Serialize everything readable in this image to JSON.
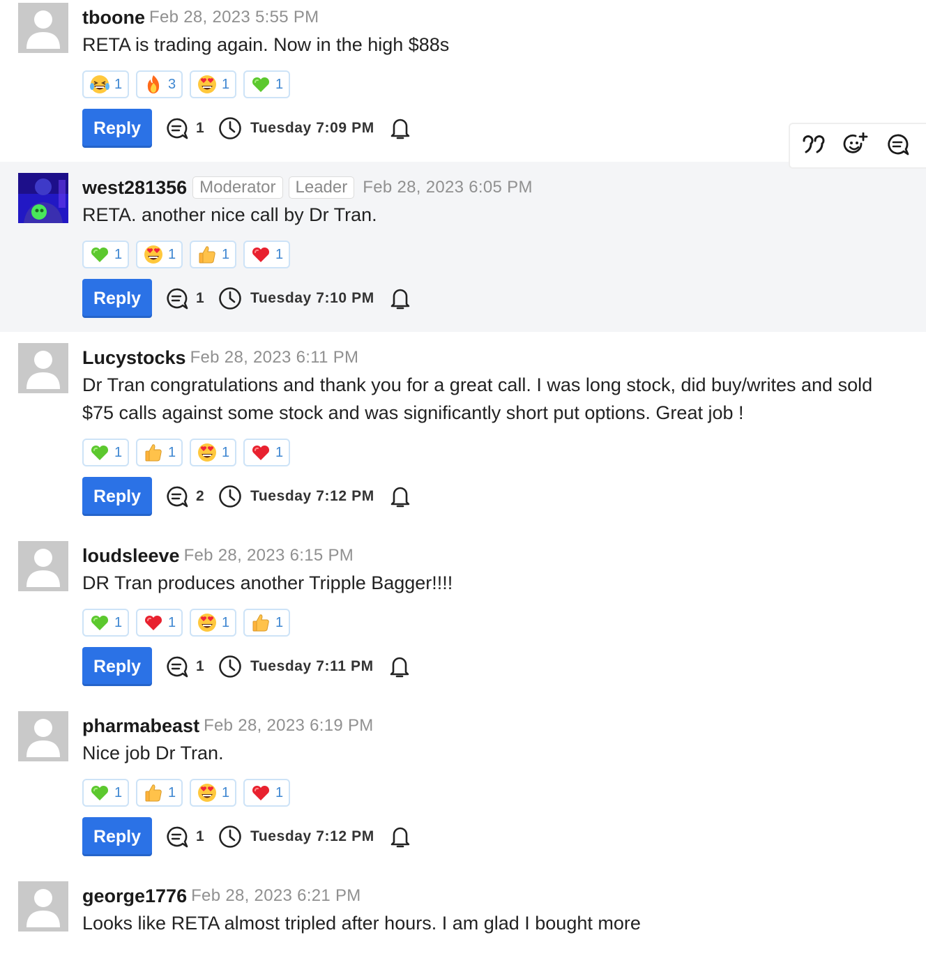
{
  "toolbar": {
    "icons": [
      "quote-icon",
      "add-reaction-icon",
      "comment-icon"
    ]
  },
  "posts": [
    {
      "username": "tboone",
      "badges": [],
      "timestamp": "Feb 28, 2023 5:55 PM",
      "body": "RETA is trading again. Now in the high $88s",
      "reactions": [
        {
          "emoji": "laughing-tears",
          "count": "1"
        },
        {
          "emoji": "fire",
          "count": "3"
        },
        {
          "emoji": "heart-eyes",
          "count": "1"
        },
        {
          "emoji": "green-heart",
          "count": "1"
        }
      ],
      "reply_label": "Reply",
      "comment_count": "1",
      "time": "Tuesday 7:09 PM"
    },
    {
      "username": "west281356",
      "badges": [
        "Moderator",
        "Leader"
      ],
      "timestamp": "Feb 28, 2023 6:05 PM",
      "body": "RETA. another nice call by Dr Tran.",
      "reactions": [
        {
          "emoji": "green-heart",
          "count": "1"
        },
        {
          "emoji": "heart-eyes",
          "count": "1"
        },
        {
          "emoji": "thumbs-up",
          "count": "1"
        },
        {
          "emoji": "red-heart",
          "count": "1"
        }
      ],
      "reply_label": "Reply",
      "comment_count": "1",
      "time": "Tuesday 7:10 PM"
    },
    {
      "username": "Lucystocks",
      "badges": [],
      "timestamp": "Feb 28, 2023 6:11 PM",
      "body": "Dr Tran congratulations and thank you for a great call. I was long stock, did buy/writes and sold $75 calls against some stock and was significantly short put options. Great job !",
      "reactions": [
        {
          "emoji": "green-heart",
          "count": "1"
        },
        {
          "emoji": "thumbs-up",
          "count": "1"
        },
        {
          "emoji": "heart-eyes",
          "count": "1"
        },
        {
          "emoji": "red-heart",
          "count": "1"
        }
      ],
      "reply_label": "Reply",
      "comment_count": "2",
      "time": "Tuesday 7:12 PM"
    },
    {
      "username": "loudsleeve",
      "badges": [],
      "timestamp": "Feb 28, 2023 6:15 PM",
      "body": "DR Tran produces another Tripple Bagger!!!!",
      "reactions": [
        {
          "emoji": "green-heart",
          "count": "1"
        },
        {
          "emoji": "red-heart",
          "count": "1"
        },
        {
          "emoji": "heart-eyes",
          "count": "1"
        },
        {
          "emoji": "thumbs-up",
          "count": "1"
        }
      ],
      "reply_label": "Reply",
      "comment_count": "1",
      "time": "Tuesday 7:11 PM"
    },
    {
      "username": "pharmabeast",
      "badges": [],
      "timestamp": "Feb 28, 2023 6:19 PM",
      "body": "Nice job Dr Tran.",
      "reactions": [
        {
          "emoji": "green-heart",
          "count": "1"
        },
        {
          "emoji": "thumbs-up",
          "count": "1"
        },
        {
          "emoji": "heart-eyes",
          "count": "1"
        },
        {
          "emoji": "red-heart",
          "count": "1"
        }
      ],
      "reply_label": "Reply",
      "comment_count": "1",
      "time": "Tuesday 7:12 PM"
    },
    {
      "username": "george1776",
      "badges": [],
      "timestamp": "Feb 28, 2023 6:21 PM",
      "body": "Looks like RETA almost tripled after hours. I am glad I bought more",
      "reactions": [],
      "reply_label": "",
      "comment_count": "",
      "time": ""
    }
  ]
}
